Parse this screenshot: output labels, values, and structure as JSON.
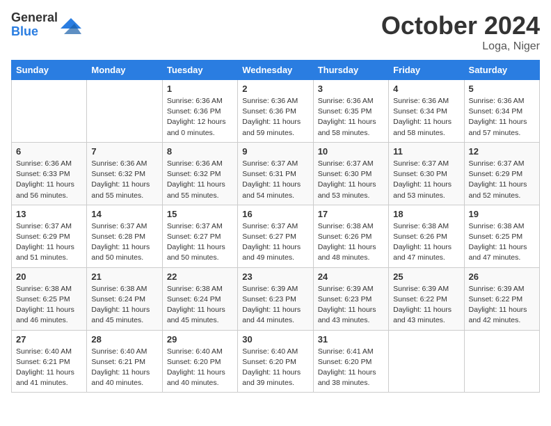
{
  "header": {
    "logo_general": "General",
    "logo_blue": "Blue",
    "month_title": "October 2024",
    "location": "Loga, Niger"
  },
  "days_of_week": [
    "Sunday",
    "Monday",
    "Tuesday",
    "Wednesday",
    "Thursday",
    "Friday",
    "Saturday"
  ],
  "weeks": [
    [
      {
        "day": "",
        "details": ""
      },
      {
        "day": "",
        "details": ""
      },
      {
        "day": "1",
        "details": "Sunrise: 6:36 AM\nSunset: 6:36 PM\nDaylight: 12 hours and 0 minutes."
      },
      {
        "day": "2",
        "details": "Sunrise: 6:36 AM\nSunset: 6:36 PM\nDaylight: 11 hours and 59 minutes."
      },
      {
        "day": "3",
        "details": "Sunrise: 6:36 AM\nSunset: 6:35 PM\nDaylight: 11 hours and 58 minutes."
      },
      {
        "day": "4",
        "details": "Sunrise: 6:36 AM\nSunset: 6:34 PM\nDaylight: 11 hours and 58 minutes."
      },
      {
        "day": "5",
        "details": "Sunrise: 6:36 AM\nSunset: 6:34 PM\nDaylight: 11 hours and 57 minutes."
      }
    ],
    [
      {
        "day": "6",
        "details": "Sunrise: 6:36 AM\nSunset: 6:33 PM\nDaylight: 11 hours and 56 minutes."
      },
      {
        "day": "7",
        "details": "Sunrise: 6:36 AM\nSunset: 6:32 PM\nDaylight: 11 hours and 55 minutes."
      },
      {
        "day": "8",
        "details": "Sunrise: 6:36 AM\nSunset: 6:32 PM\nDaylight: 11 hours and 55 minutes."
      },
      {
        "day": "9",
        "details": "Sunrise: 6:37 AM\nSunset: 6:31 PM\nDaylight: 11 hours and 54 minutes."
      },
      {
        "day": "10",
        "details": "Sunrise: 6:37 AM\nSunset: 6:30 PM\nDaylight: 11 hours and 53 minutes."
      },
      {
        "day": "11",
        "details": "Sunrise: 6:37 AM\nSunset: 6:30 PM\nDaylight: 11 hours and 53 minutes."
      },
      {
        "day": "12",
        "details": "Sunrise: 6:37 AM\nSunset: 6:29 PM\nDaylight: 11 hours and 52 minutes."
      }
    ],
    [
      {
        "day": "13",
        "details": "Sunrise: 6:37 AM\nSunset: 6:29 PM\nDaylight: 11 hours and 51 minutes."
      },
      {
        "day": "14",
        "details": "Sunrise: 6:37 AM\nSunset: 6:28 PM\nDaylight: 11 hours and 50 minutes."
      },
      {
        "day": "15",
        "details": "Sunrise: 6:37 AM\nSunset: 6:27 PM\nDaylight: 11 hours and 50 minutes."
      },
      {
        "day": "16",
        "details": "Sunrise: 6:37 AM\nSunset: 6:27 PM\nDaylight: 11 hours and 49 minutes."
      },
      {
        "day": "17",
        "details": "Sunrise: 6:38 AM\nSunset: 6:26 PM\nDaylight: 11 hours and 48 minutes."
      },
      {
        "day": "18",
        "details": "Sunrise: 6:38 AM\nSunset: 6:26 PM\nDaylight: 11 hours and 47 minutes."
      },
      {
        "day": "19",
        "details": "Sunrise: 6:38 AM\nSunset: 6:25 PM\nDaylight: 11 hours and 47 minutes."
      }
    ],
    [
      {
        "day": "20",
        "details": "Sunrise: 6:38 AM\nSunset: 6:25 PM\nDaylight: 11 hours and 46 minutes."
      },
      {
        "day": "21",
        "details": "Sunrise: 6:38 AM\nSunset: 6:24 PM\nDaylight: 11 hours and 45 minutes."
      },
      {
        "day": "22",
        "details": "Sunrise: 6:38 AM\nSunset: 6:24 PM\nDaylight: 11 hours and 45 minutes."
      },
      {
        "day": "23",
        "details": "Sunrise: 6:39 AM\nSunset: 6:23 PM\nDaylight: 11 hours and 44 minutes."
      },
      {
        "day": "24",
        "details": "Sunrise: 6:39 AM\nSunset: 6:23 PM\nDaylight: 11 hours and 43 minutes."
      },
      {
        "day": "25",
        "details": "Sunrise: 6:39 AM\nSunset: 6:22 PM\nDaylight: 11 hours and 43 minutes."
      },
      {
        "day": "26",
        "details": "Sunrise: 6:39 AM\nSunset: 6:22 PM\nDaylight: 11 hours and 42 minutes."
      }
    ],
    [
      {
        "day": "27",
        "details": "Sunrise: 6:40 AM\nSunset: 6:21 PM\nDaylight: 11 hours and 41 minutes."
      },
      {
        "day": "28",
        "details": "Sunrise: 6:40 AM\nSunset: 6:21 PM\nDaylight: 11 hours and 40 minutes."
      },
      {
        "day": "29",
        "details": "Sunrise: 6:40 AM\nSunset: 6:20 PM\nDaylight: 11 hours and 40 minutes."
      },
      {
        "day": "30",
        "details": "Sunrise: 6:40 AM\nSunset: 6:20 PM\nDaylight: 11 hours and 39 minutes."
      },
      {
        "day": "31",
        "details": "Sunrise: 6:41 AM\nSunset: 6:20 PM\nDaylight: 11 hours and 38 minutes."
      },
      {
        "day": "",
        "details": ""
      },
      {
        "day": "",
        "details": ""
      }
    ]
  ]
}
